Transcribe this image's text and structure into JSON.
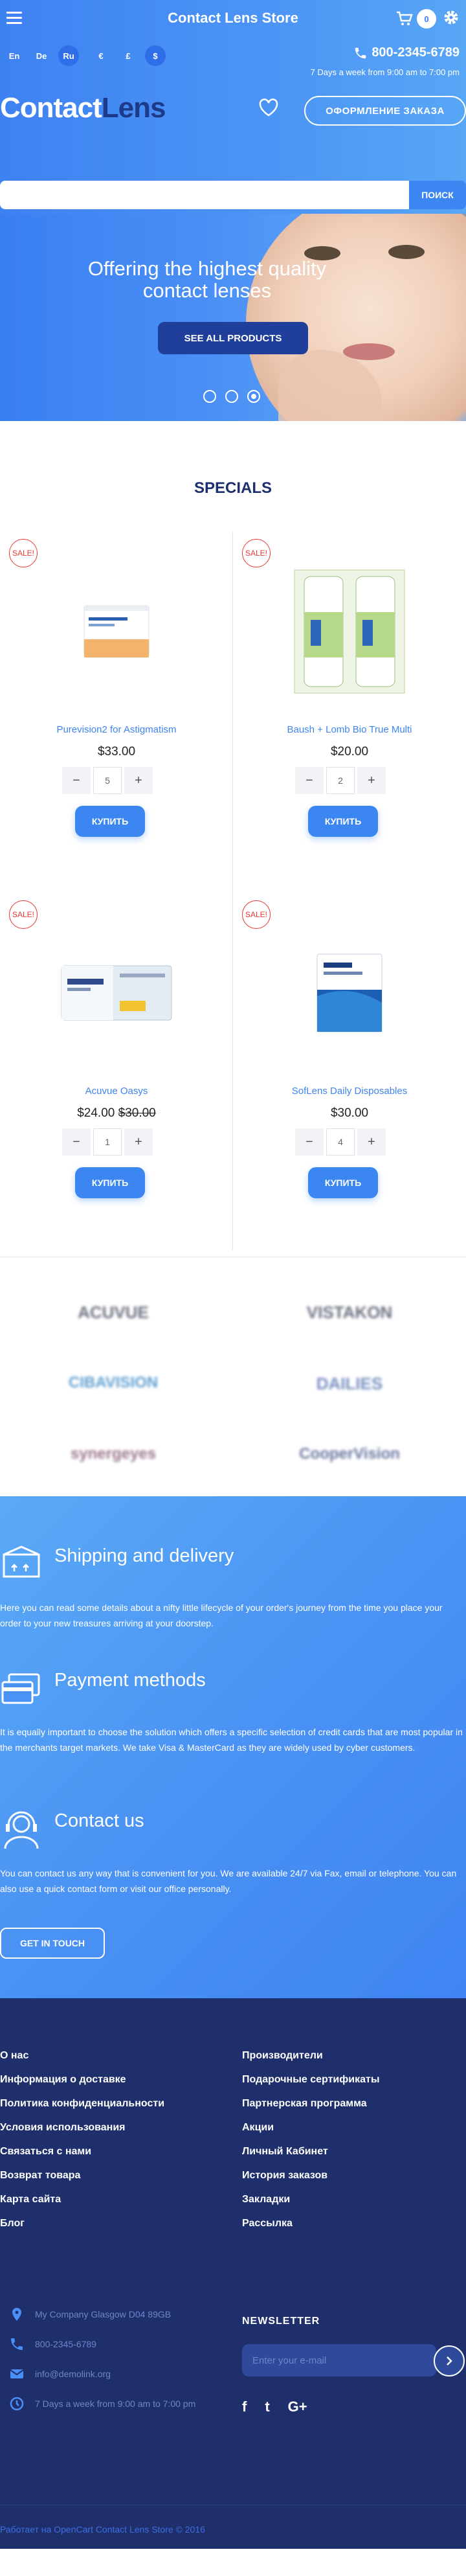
{
  "header": {
    "store_title": "Contact Lens Store",
    "cart_count": "0",
    "languages": [
      "En",
      "De",
      "Ru"
    ],
    "active_language": "Ru",
    "currencies": [
      "€",
      "£",
      "$"
    ],
    "active_currency": "$",
    "phone": "800-2345-6789",
    "hours": "7 Days a week from 9:00 am to 7:00 pm",
    "logo_part1": "Contact",
    "logo_part2": "Lens",
    "order_button": "ОФОРМЛЕНИЕ ЗАКАЗА",
    "search_placeholder": "",
    "search_button": "ПОИСК"
  },
  "hero": {
    "title": "Offering the highest quality contact lenses",
    "button": "SEE ALL PRODUCTS",
    "slide_count": 3,
    "active_slide": 3
  },
  "specials": {
    "title": "SPECIALS",
    "products": [
      {
        "name": "Purevision2 for Astigmatism",
        "price": "$33.00",
        "old_price": "",
        "qty": "5",
        "sale": "SALE!",
        "buy": "КУПИТЬ"
      },
      {
        "name": "Baush + Lomb Bio True Multi",
        "price": "$20.00",
        "old_price": "",
        "qty": "2",
        "sale": "SALE!",
        "buy": "КУПИТЬ"
      },
      {
        "name": "Acuvue Oasys",
        "price": "$24.00",
        "old_price": "$30.00",
        "qty": "1",
        "sale": "SALE!",
        "buy": "КУПИТЬ"
      },
      {
        "name": "SofLens Daily Disposables",
        "price": "$30.00",
        "old_price": "",
        "qty": "4",
        "sale": "SALE!",
        "buy": "КУПИТЬ"
      }
    ],
    "qty_minus": "−",
    "qty_plus": "+"
  },
  "brands": [
    "ACUVUE",
    "VISTAKON",
    "CIBAVISION",
    "DAILIES",
    "synergeyes",
    "CooperVision"
  ],
  "info": {
    "blocks": [
      {
        "title": "Shipping and delivery",
        "text": "Here you can read some details about a nifty little lifecycle of your order's journey from the time you place your order to your new treasures arriving at your doorstep."
      },
      {
        "title": "Payment methods",
        "text": "It is equally important to choose the solution which offers a specific selection of credit cards that are most popular in the merchants target markets. We take Visa & MasterCard as they are widely used by cyber customers."
      },
      {
        "title": "Contact us",
        "text": "You can contact us any way that is convenient for you. We are available 24/7 via Fax, email or telephone. You can also use a quick contact form or visit our office personally."
      }
    ],
    "button": "GET IN TOUCH"
  },
  "footer": {
    "col1": [
      "О нас",
      "Информация о доставке",
      "Политика конфиденциальности",
      "Условия использования",
      "Связаться с нами",
      "Возврат товара",
      "Карта сайта",
      "Блог"
    ],
    "col2": [
      "Производители",
      "Подарочные сертификаты",
      "Партнерская программа",
      "Акции",
      "Личный Кабинет",
      "История заказов",
      "Закладки",
      "Рассылка"
    ],
    "address": "My Company Glasgow D04 89GB",
    "phone": "800-2345-6789",
    "email": "info@demolink.org",
    "hours": "7 Days a week from 9:00 am to 7:00 pm",
    "newsletter_title": "NEWSLETTER",
    "newsletter_placeholder": "Enter your e-mail",
    "social": [
      "f",
      "t",
      "G+"
    ],
    "copyright": "Работает на OpenCart Contact Lens Store © 2016"
  },
  "colors": {
    "primary": "#3e84f0",
    "dark": "#1f2f6b",
    "accent_dark": "#1f3f9a",
    "sale": "#e53935"
  }
}
